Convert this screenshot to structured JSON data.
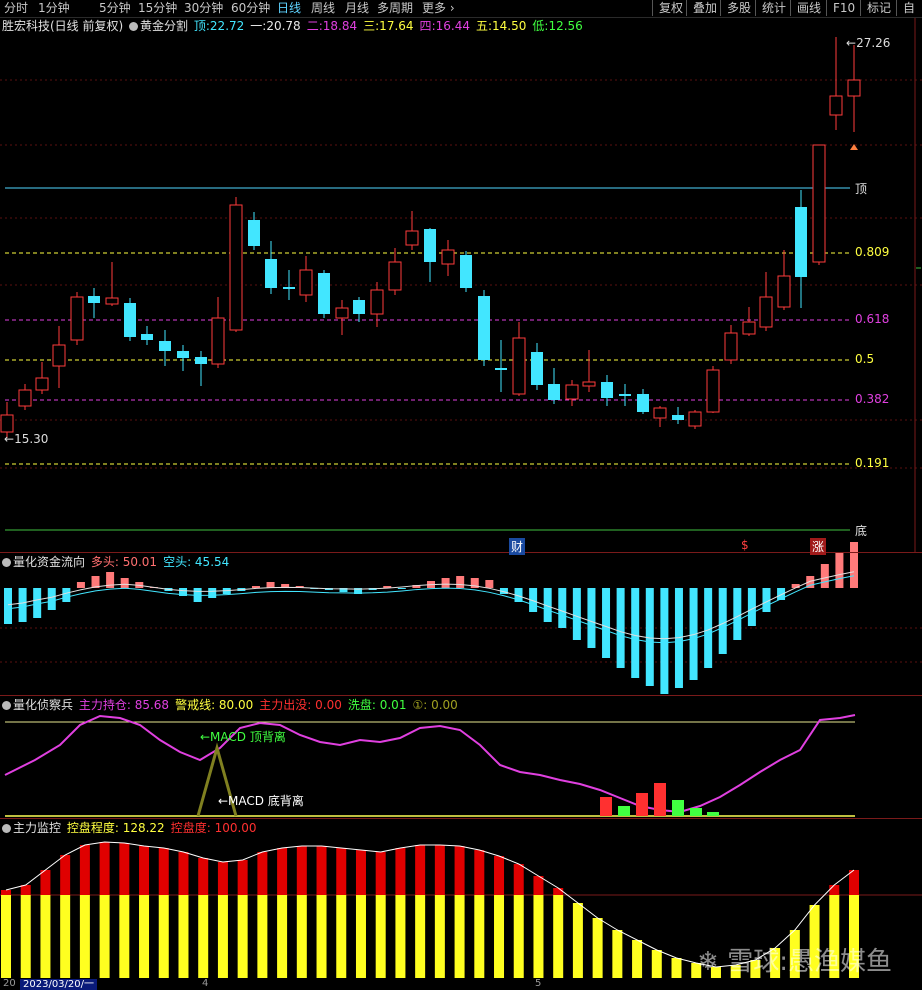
{
  "toolbar": {
    "tabs": [
      "分时",
      "1分钟",
      "5分钟",
      "15分钟",
      "30分钟",
      "60分钟",
      "日线",
      "周线",
      "月线",
      "多周期",
      "更多"
    ],
    "active_tab": "日线",
    "right_buttons": [
      "复权",
      "叠加",
      "多股",
      "统计",
      "画线",
      "F10",
      "标记",
      "自"
    ]
  },
  "main_panel": {
    "stock_title": "胜宏科技(日线 前复权)",
    "indicator_name": "黄金分割",
    "legend": [
      {
        "label": "顶",
        "value": "22.72",
        "color": "#42e6ff"
      },
      {
        "label": "一",
        "value": "20.78",
        "color": "#e8e8e8"
      },
      {
        "label": "二",
        "value": "18.84",
        "color": "#e040e0"
      },
      {
        "label": "三",
        "value": "17.64",
        "color": "#ffff40"
      },
      {
        "label": "四",
        "value": "16.44",
        "color": "#e040e0"
      },
      {
        "label": "五",
        "value": "14.50",
        "color": "#ffff40"
      },
      {
        "label": "低",
        "value": "12.56",
        "color": "#40ff40"
      }
    ],
    "levels": [
      {
        "label": "顶",
        "color": "#4fd6ff"
      },
      {
        "label": "0.809",
        "color": "#ffff40"
      },
      {
        "label": "0.618",
        "color": "#e040e0"
      },
      {
        "label": "0.5",
        "color": "#ffff40"
      },
      {
        "label": "0.382",
        "color": "#e040e0"
      },
      {
        "label": "0.191",
        "color": "#ffff40"
      },
      {
        "label": "底",
        "color": "#40c040"
      }
    ],
    "high_label": "27.26",
    "low_label": "15.30",
    "markers": [
      {
        "text": "财",
        "color": "#ffffff",
        "bg": "#1a4aa0"
      },
      {
        "text": "$",
        "color": "#ff4040",
        "bg": ""
      },
      {
        "text": "涨",
        "color": "#ffffff",
        "bg": "#a01a1a"
      }
    ]
  },
  "fund_flow_panel": {
    "name": "量化资金流向",
    "legend": [
      {
        "label": "多头:",
        "value": "50.01",
        "color": "#ff7070"
      },
      {
        "label": "空头:",
        "value": "45.54",
        "color": "#42e6ff"
      }
    ]
  },
  "scout_panel": {
    "name": "量化侦察兵",
    "legend": [
      {
        "label": "主力持仓:",
        "value": "85.68",
        "color": "#e040e0"
      },
      {
        "label": "警戒线:",
        "value": "80.00",
        "color": "#ffff40"
      },
      {
        "label": "主力出没:",
        "value": "0.00",
        "color": "#ff3030"
      },
      {
        "label": "洗盘:",
        "value": "0.01",
        "color": "#40ff40"
      },
      {
        "label": "①:",
        "value": "0.00",
        "color": "#a0a020"
      }
    ],
    "annotations": [
      {
        "text": "←MACD 顶背离",
        "color": "#40ff40"
      },
      {
        "text": "←MACD 底背离",
        "color": "#ffffff"
      }
    ]
  },
  "control_panel": {
    "name": "主力监控",
    "legend": [
      {
        "label": "控盘程度:",
        "value": "128.22",
        "color": "#ffff40"
      },
      {
        "label": "控盘度:",
        "value": "100.00",
        "color": "#ff3030"
      }
    ]
  },
  "bottom_axis": {
    "date_box": "2023/03/20/一",
    "left_fragment": "20",
    "ticks": [
      "4",
      "5"
    ]
  },
  "watermark": "雪球:愚渔媒鱼",
  "colors": {
    "up": "#ff3b3b",
    "down": "#42e6ff"
  }
}
